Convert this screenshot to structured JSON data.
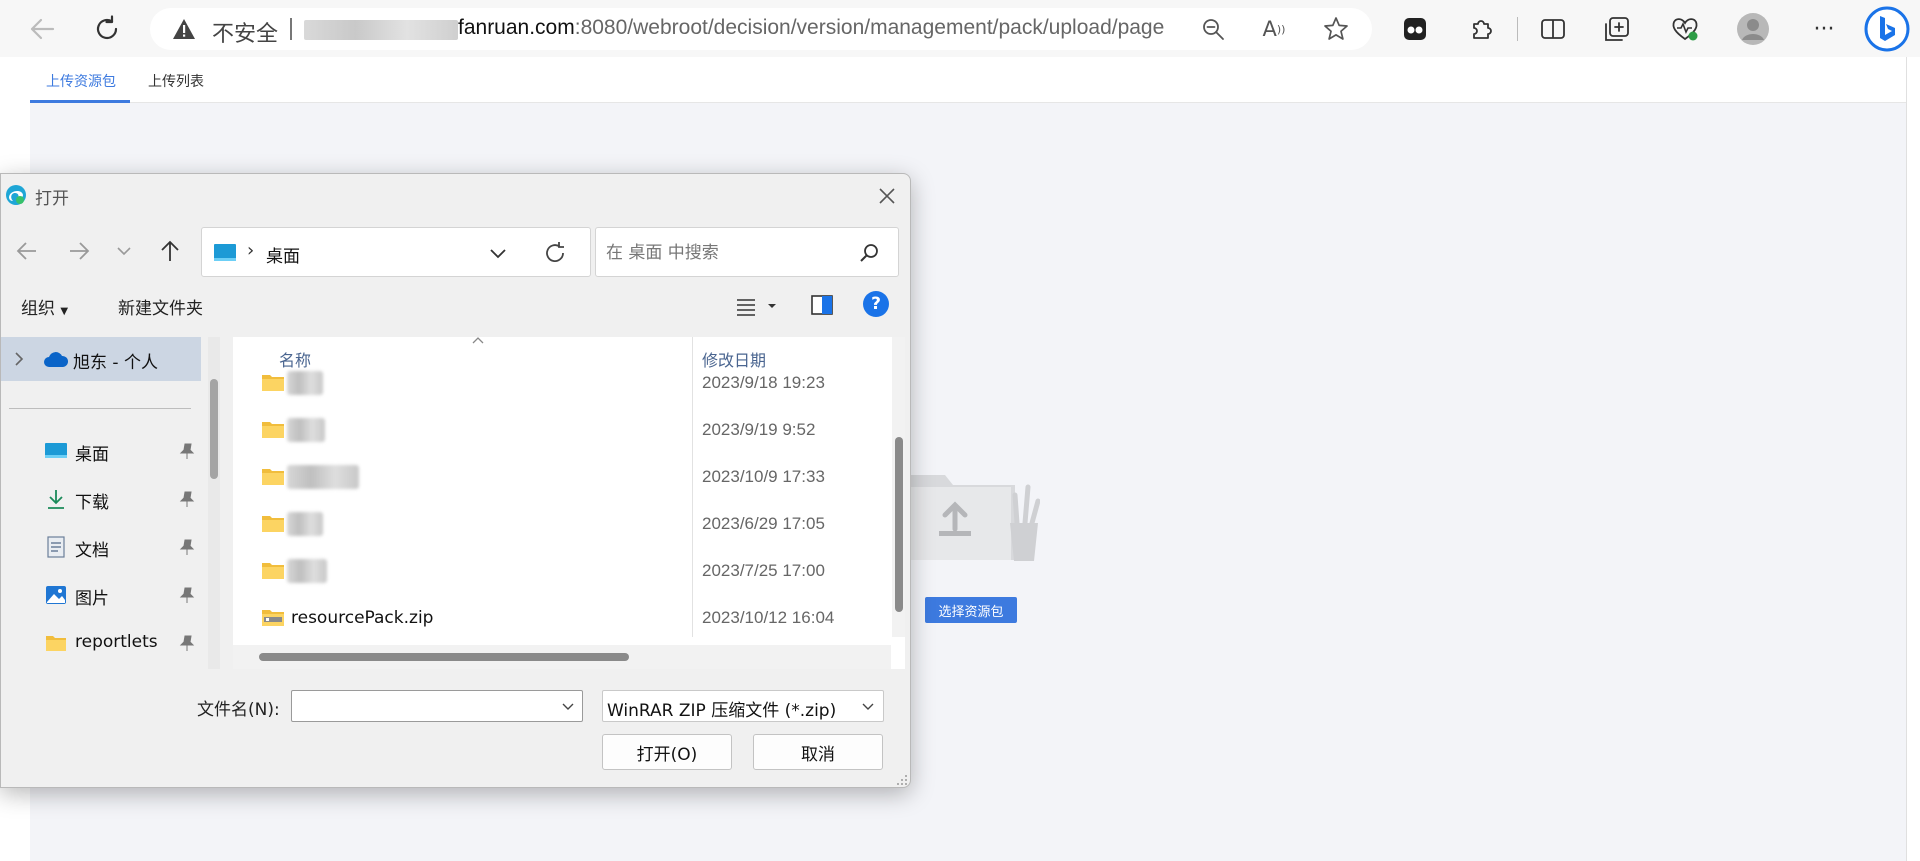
{
  "browser": {
    "address": {
      "security_label": "不安全",
      "url_host": "fanruan.com",
      "url_path": ":8080/webroot/decision/version/management/pack/upload/page"
    }
  },
  "page": {
    "tabs": [
      {
        "label": "上传资源包",
        "active": true
      },
      {
        "label": "上传列表",
        "active": false
      }
    ],
    "select_button_label": "选择资源包",
    "accent_color": "#3d7adf"
  },
  "dialog": {
    "title": "打开",
    "path": {
      "label": "桌面"
    },
    "search_placeholder": "在 桌面 中搜索",
    "commands": {
      "organize": "组织",
      "new_folder": "新建文件夹"
    },
    "nav": {
      "onedrive": "旭东 - 个人",
      "quick_access": [
        {
          "label": "桌面",
          "icon": "desktop-icon"
        },
        {
          "label": "下载",
          "icon": "download-icon"
        },
        {
          "label": "文档",
          "icon": "document-icon"
        },
        {
          "label": "图片",
          "icon": "pictures-icon"
        },
        {
          "label": "reportlets",
          "icon": "folder-icon"
        }
      ]
    },
    "columns": {
      "name": "名称",
      "date": "修改日期"
    },
    "files": [
      {
        "name": "",
        "date": "2023/9/18 19:23",
        "type": "folder"
      },
      {
        "name": "",
        "date": "2023/9/19 9:52",
        "type": "folder"
      },
      {
        "name": "",
        "date": "2023/10/9 17:33",
        "type": "folder"
      },
      {
        "name": "",
        "date": "2023/6/29 17:05",
        "type": "folder"
      },
      {
        "name": "",
        "date": "2023/7/25 17:00",
        "type": "folder"
      },
      {
        "name": "resourcePack.zip",
        "date": "2023/10/12 16:04",
        "type": "zip"
      }
    ],
    "filename_label": "文件名(N):",
    "filename_value": "",
    "filetype": "WinRAR ZIP 压缩文件 (*.zip)",
    "open_label": "打开(O)",
    "cancel_label": "取消"
  }
}
